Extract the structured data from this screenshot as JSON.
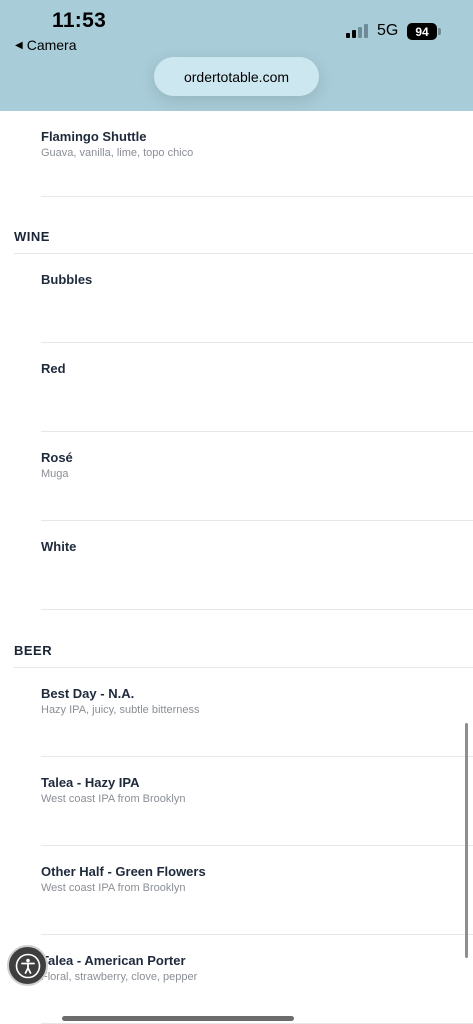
{
  "status_bar": {
    "time": "11:53",
    "back_label": "Camera",
    "network": "5G",
    "battery": "94"
  },
  "browser": {
    "url": "ordertotable.com"
  },
  "menu": {
    "top_item": {
      "name": "Flamingo Shuttle",
      "desc": "Guava, vanilla, lime, topo chico"
    },
    "wine": {
      "title": "WINE",
      "items": [
        {
          "name": "Bubbles",
          "desc": ""
        },
        {
          "name": "Red",
          "desc": ""
        },
        {
          "name": "Rosé",
          "desc": "Muga"
        },
        {
          "name": "White",
          "desc": ""
        }
      ]
    },
    "beer": {
      "title": "BEER",
      "items": [
        {
          "name": "Best Day - N.A.",
          "desc": "Hazy IPA, juicy, subtle bitterness"
        },
        {
          "name": "Talea - Hazy IPA",
          "desc": "West coast IPA from Brooklyn"
        },
        {
          "name": "Other Half - Green Flowers",
          "desc": "West coast IPA from Brooklyn"
        },
        {
          "name": "Talea - American Porter",
          "desc": "Floral, strawberry, clove, pepper"
        }
      ]
    }
  },
  "icons": {
    "accessibility": "accessibility-icon",
    "back": "back-triangle-icon"
  },
  "colors": {
    "header_bg": "#a8ccd8",
    "url_pill_bg": "#cde7f0",
    "text_dark": "#1e2a3c",
    "text_muted": "#8a8f96"
  }
}
